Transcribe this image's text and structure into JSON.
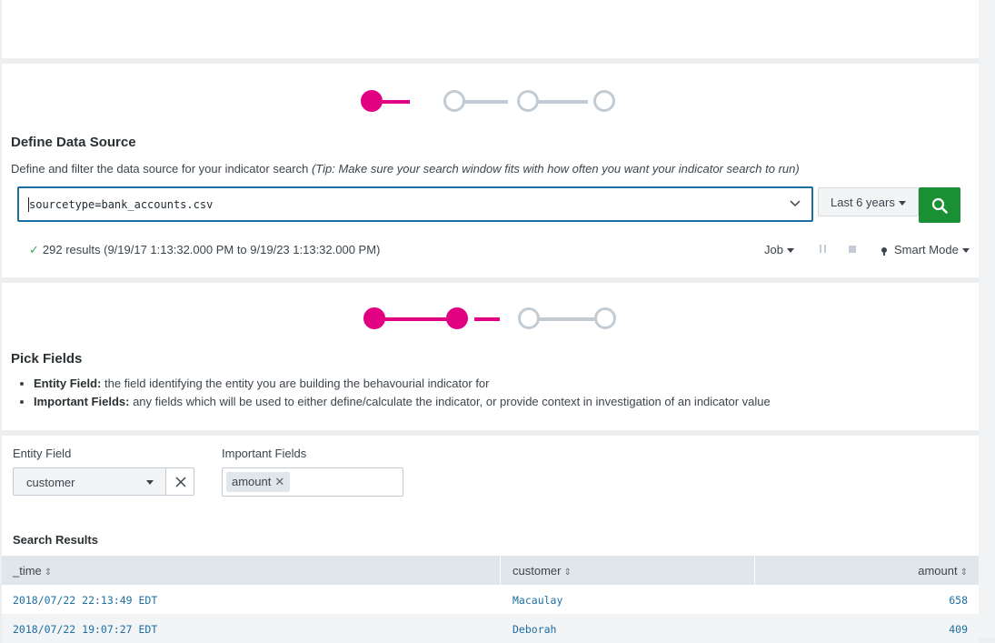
{
  "define_source": {
    "title": "Define Data Source",
    "description": "Define and filter the data source for your indicator search ",
    "tip": "(Tip: Make sure your search window fits with how often you want your indicator search to run)",
    "query": "sourcetype=bank_accounts.csv",
    "time_range": "Last 6 years",
    "status": "292 results (9/19/17 1:13:32.000 PM to 9/19/23 1:13:32.000 PM)",
    "job_label": "Job",
    "mode_label": "Smart Mode"
  },
  "pick_fields": {
    "title": "Pick Fields",
    "bullets": [
      {
        "term": "Entity Field:",
        "text": " the field identifying the entity you are building the behavourial indicator for"
      },
      {
        "term": "Important Fields:",
        "text": " any fields which will be used to either define/calculate the indicator, or provide context in investigation of an indicator value"
      }
    ]
  },
  "form": {
    "entity_label": "Entity Field",
    "entity_value": "customer",
    "important_label": "Important Fields",
    "important_chips": [
      "amount"
    ]
  },
  "results": {
    "title": "Search Results",
    "columns": [
      "_time",
      "customer",
      "amount"
    ],
    "rows": [
      [
        "2018/07/22 22:13:49 EDT",
        "Macaulay",
        "658"
      ],
      [
        "2018/07/22 19:07:27 EDT",
        "Deborah",
        "409"
      ]
    ]
  },
  "colors": {
    "accent_magenta": "#e20082",
    "go_green": "#1a9035",
    "focus_blue": "#1a6fa0"
  }
}
